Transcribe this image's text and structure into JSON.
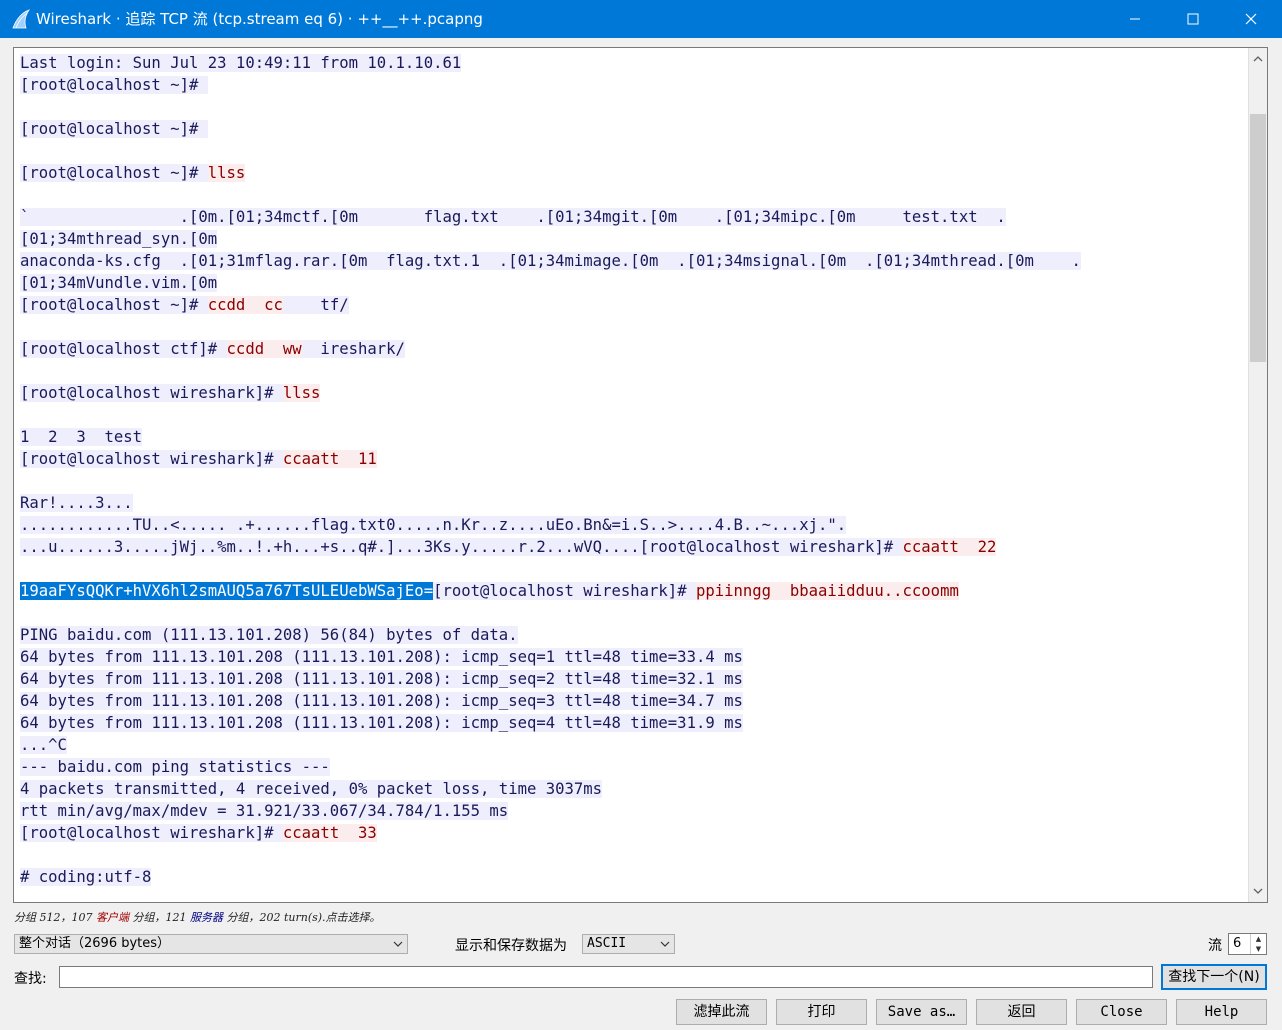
{
  "window": {
    "title": "Wireshark · 追踪 TCP 流 (tcp.stream eq 6) · ++__++.pcapng"
  },
  "stream": [
    [
      [
        "c",
        "Last login: Sun Jul 23 10:49:11 from 10.1.10.61"
      ]
    ],
    [
      [
        "c",
        "[root@localhost ~]# "
      ]
    ],
    [],
    [
      [
        "c",
        "[root@localhost ~]# "
      ]
    ],
    [],
    [
      [
        "c",
        "[root@localhost ~]# "
      ],
      [
        "s",
        "llss"
      ]
    ],
    [],
    [
      [
        "c",
        "`                .[0m.[01;34mctf.[0m       flag.txt    .[01;34mgit.[0m    .[01;34mipc.[0m     test.txt  ."
      ]
    ],
    [
      [
        "c",
        "[01;34mthread_syn.[0m"
      ]
    ],
    [
      [
        "c",
        "anaconda-ks.cfg  .[01;31mflag.rar.[0m  flag.txt.1  .[01;34mimage.[0m  .[01;34msignal.[0m  .[01;34mthread.[0m    ."
      ]
    ],
    [
      [
        "c",
        "[01;34mVundle.vim.[0m"
      ]
    ],
    [
      [
        "c",
        "[root@localhost ~]# "
      ],
      [
        "s",
        "ccdd  cc"
      ],
      [
        "c",
        "    tf/"
      ]
    ],
    [],
    [
      [
        "c",
        "[root@localhost ctf]# "
      ],
      [
        "s",
        "ccdd  ww"
      ],
      [
        "c",
        "  ireshark/"
      ]
    ],
    [],
    [
      [
        "c",
        "[root@localhost wireshark]# "
      ],
      [
        "s",
        "llss"
      ]
    ],
    [],
    [
      [
        "c",
        "1  2  3  test"
      ]
    ],
    [
      [
        "c",
        "[root@localhost wireshark]# "
      ],
      [
        "s",
        "ccaatt  11"
      ]
    ],
    [],
    [
      [
        "c",
        "Rar!....3..."
      ]
    ],
    [
      [
        "c",
        "............TU..<..... .+......flag.txt0.....n.Kr..z....uEo.Bn&=i.S..>....4.B..~...xj.\"."
      ]
    ],
    [
      [
        "c",
        "...u......3.....jWj..%m..!.+h...+s..q#.]...3Ks.y.....r.2...wVQ....[root@localhost wireshark]# "
      ],
      [
        "s",
        "ccaatt  22"
      ]
    ],
    [],
    [
      [
        "sel",
        "19aaFYsQQKr+hVX6hl2smAUQ5a767TsULEUebWSajEo="
      ],
      [
        "c",
        "[root@localhost wireshark]# "
      ],
      [
        "s",
        "ppiinngg  bbaaiidduu..ccoomm"
      ]
    ],
    [],
    [
      [
        "c",
        "PING baidu.com (111.13.101.208) 56(84) bytes of data."
      ]
    ],
    [
      [
        "c",
        "64 bytes from 111.13.101.208 (111.13.101.208): icmp_seq=1 ttl=48 time=33.4 ms"
      ]
    ],
    [
      [
        "c",
        "64 bytes from 111.13.101.208 (111.13.101.208): icmp_seq=2 ttl=48 time=32.1 ms"
      ]
    ],
    [
      [
        "c",
        "64 bytes from 111.13.101.208 (111.13.101.208): icmp_seq=3 ttl=48 time=34.7 ms"
      ]
    ],
    [
      [
        "c",
        "64 bytes from 111.13.101.208 (111.13.101.208): icmp_seq=4 ttl=48 time=31.9 ms"
      ]
    ],
    [
      [
        "c",
        "...^C"
      ]
    ],
    [
      [
        "c",
        "--- baidu.com ping statistics ---"
      ]
    ],
    [
      [
        "c",
        "4 packets transmitted, 4 received, 0% packet loss, time 3037ms"
      ]
    ],
    [
      [
        "c",
        "rtt min/avg/max/mdev = 31.921/33.067/34.784/1.155 ms"
      ]
    ],
    [
      [
        "c",
        "[root@localhost wireshark]# "
      ],
      [
        "s",
        "ccaatt  33"
      ]
    ],
    [],
    [
      [
        "c",
        "# coding:utf-8"
      ]
    ]
  ],
  "status": {
    "prefix": "分组 512，107 ",
    "client": "客户端",
    "middle": " 分组，121 ",
    "server": "服务器",
    "suffix": " 分组，202 turn(s).点击选择。"
  },
  "conversation_select": {
    "value": "整个对话（2696 bytes）"
  },
  "show_save_label": "显示和保存数据为",
  "format_select": {
    "value": "ASCII"
  },
  "stream_label": "流",
  "stream_number": "6",
  "find_label": "查找:",
  "find_input": {
    "value": ""
  },
  "buttons": {
    "find_next": "查找下一个(N)",
    "filter_out": "滤掉此流",
    "print": "打印",
    "save_as": "Save as…",
    "back": "返回",
    "close": "Close",
    "help": "Help"
  },
  "colors": {
    "titlebar": "#0078d7",
    "client_bg": "#eeeefc",
    "client_fg": "#1a1a5a",
    "server_bg": "#fbeded",
    "server_fg": "#8b0000",
    "selection_bg": "#0078d7"
  },
  "icons": {
    "app": "wireshark-fin-icon",
    "minimize": "minimize-icon",
    "maximize": "maximize-icon",
    "close": "close-icon"
  }
}
